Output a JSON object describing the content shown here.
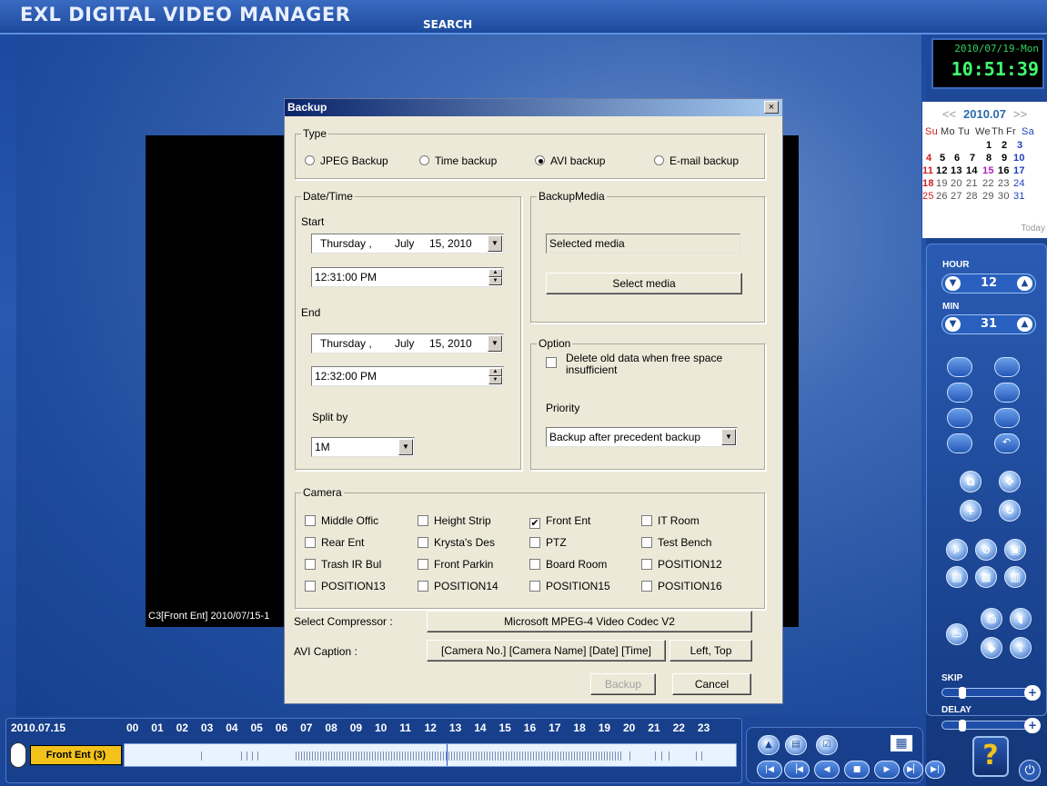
{
  "app": {
    "title": "EXL DIGITAL VIDEO MANAGER",
    "tab": "SEARCH"
  },
  "video": {
    "caption": "C3[Front Ent] 2010/07/15-1"
  },
  "clock": {
    "date": "2010/07/19-Mon",
    "time": "10:51:39"
  },
  "calendar": {
    "prev": "<<",
    "next": ">>",
    "month": "2010.07",
    "days_header": [
      "Su",
      "Mo",
      "Tu",
      "We",
      "Th",
      "Fr",
      "Sa"
    ],
    "weeks": [
      [
        "",
        "",
        "",
        "",
        "1",
        "2",
        "3"
      ],
      [
        "4",
        "5",
        "6",
        "7",
        "8",
        "9",
        "10"
      ],
      [
        "11",
        "12",
        "13",
        "14",
        "15",
        "16",
        "17"
      ],
      [
        "18",
        "19",
        "20",
        "21",
        "22",
        "23",
        "24"
      ],
      [
        "25",
        "26",
        "27",
        "28",
        "29",
        "30",
        "31"
      ]
    ],
    "today_label": "Today"
  },
  "controls": {
    "hour_label": "HOUR",
    "hour_value": "12",
    "min_label": "MIN",
    "min_value": "31",
    "skip_label": "SKIP",
    "delay_label": "DELAY",
    "help": "?"
  },
  "timeline": {
    "date": "2010.07.15",
    "hours": [
      "00",
      "01",
      "02",
      "03",
      "04",
      "05",
      "06",
      "07",
      "08",
      "09",
      "10",
      "11",
      "12",
      "13",
      "14",
      "15",
      "16",
      "17",
      "18",
      "19",
      "20",
      "21",
      "22",
      "23"
    ],
    "camera": "Front Ent (3)"
  },
  "dialog": {
    "title": "Backup",
    "close": "×",
    "type": {
      "label": "Type",
      "options": [
        "JPEG Backup",
        "Time backup",
        "AVI backup",
        "E-mail backup"
      ],
      "selected": "AVI backup"
    },
    "datetime": {
      "label": "Date/Time",
      "start_label": "Start",
      "start_date": {
        "weekday": "Thursday ,",
        "month": "July",
        "day_year": "15, 2010"
      },
      "start_time": "12:31:00 PM",
      "end_label": "End",
      "end_date": {
        "weekday": "Thursday ,",
        "month": "July",
        "day_year": "15, 2010"
      },
      "end_time": "12:32:00 PM",
      "split_label": "Split by",
      "split_value": "1M"
    },
    "media": {
      "label": "BackupMedia",
      "selected_text": "Selected media",
      "select_button": "Select media"
    },
    "option": {
      "label": "Option",
      "delete_old": "Delete old data when free space insufficient",
      "delete_checked": false,
      "priority_label": "Priority",
      "priority_value": "Backup after precedent backup"
    },
    "camera": {
      "label": "Camera",
      "items": [
        {
          "name": "Middle Offic",
          "checked": false
        },
        {
          "name": "Height Strip",
          "checked": false
        },
        {
          "name": "Front Ent",
          "checked": true
        },
        {
          "name": "IT Room",
          "checked": false
        },
        {
          "name": "Rear Ent",
          "checked": false
        },
        {
          "name": "Krysta's Des",
          "checked": false
        },
        {
          "name": "PTZ",
          "checked": false
        },
        {
          "name": "Test Bench",
          "checked": false
        },
        {
          "name": "Trash IR Bul",
          "checked": false
        },
        {
          "name": "Front Parkin",
          "checked": false
        },
        {
          "name": "Board Room",
          "checked": false
        },
        {
          "name": "POSITION12",
          "checked": false
        },
        {
          "name": "POSITION13",
          "checked": false
        },
        {
          "name": "POSITION14",
          "checked": false
        },
        {
          "name": "POSITION15",
          "checked": false
        },
        {
          "name": "POSITION16",
          "checked": false
        }
      ]
    },
    "compressor_label": "Select Compressor :",
    "compressor_value": "Microsoft MPEG-4 Video Codec V2",
    "caption_label": "AVI Caption :",
    "caption_value": "[Camera No.] [Camera Name] [Date] [Time]",
    "caption_pos": "Left, Top",
    "backup_button": "Backup",
    "cancel_button": "Cancel"
  }
}
